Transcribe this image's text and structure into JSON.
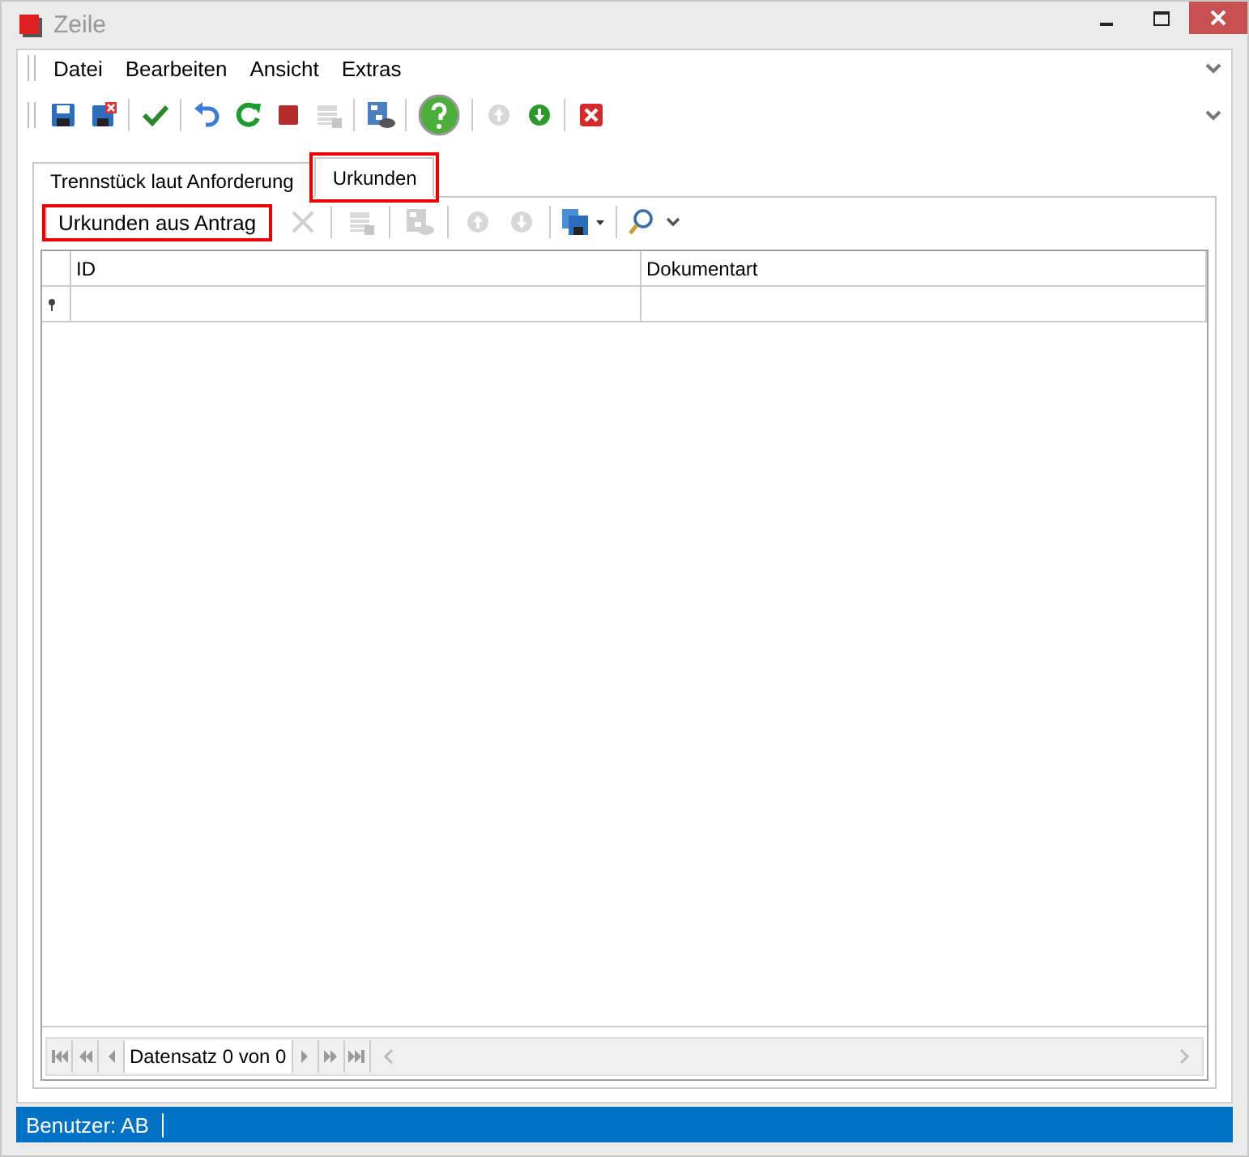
{
  "window": {
    "title": "Zeile"
  },
  "menu": [
    "Datei",
    "Bearbeiten",
    "Ansicht",
    "Extras"
  ],
  "toolbar": [
    {
      "kind": "save",
      "disabled": false
    },
    {
      "kind": "save-close",
      "disabled": false
    },
    {
      "kind": "sep"
    },
    {
      "kind": "check",
      "disabled": false
    },
    {
      "kind": "sep"
    },
    {
      "kind": "undo",
      "disabled": false
    },
    {
      "kind": "refresh",
      "disabled": false
    },
    {
      "kind": "stop",
      "disabled": false
    },
    {
      "kind": "grid",
      "disabled": true
    },
    {
      "kind": "sep"
    },
    {
      "kind": "diagram",
      "disabled": false
    },
    {
      "kind": "sep"
    },
    {
      "kind": "help",
      "disabled": false
    },
    {
      "kind": "sep"
    },
    {
      "kind": "up",
      "disabled": true
    },
    {
      "kind": "down",
      "disabled": false
    },
    {
      "kind": "sep"
    },
    {
      "kind": "close",
      "disabled": false
    }
  ],
  "tabs": [
    {
      "label": "Trennstück laut Anforderung",
      "selected": false,
      "highlighted": false
    },
    {
      "label": "Urkunden",
      "selected": true,
      "highlighted": true
    }
  ],
  "subtoolbar": {
    "button": {
      "label": "Urkunden aus Antrag",
      "highlighted": true
    },
    "items": [
      {
        "kind": "delete",
        "disabled": true
      },
      {
        "kind": "sep"
      },
      {
        "kind": "grid",
        "disabled": true
      },
      {
        "kind": "sep"
      },
      {
        "kind": "diagram",
        "disabled": true
      },
      {
        "kind": "sep"
      },
      {
        "kind": "up",
        "disabled": true
      },
      {
        "kind": "down",
        "disabled": true
      },
      {
        "kind": "sep"
      },
      {
        "kind": "save-menu",
        "disabled": false
      },
      {
        "kind": "sep"
      },
      {
        "kind": "search-menu",
        "disabled": false
      }
    ]
  },
  "table": {
    "columns": [
      "ID",
      "Dokumentart"
    ]
  },
  "navigator": {
    "text": "Datensatz 0 von 0"
  },
  "status_bar": {
    "user": "Benutzer: AB"
  }
}
